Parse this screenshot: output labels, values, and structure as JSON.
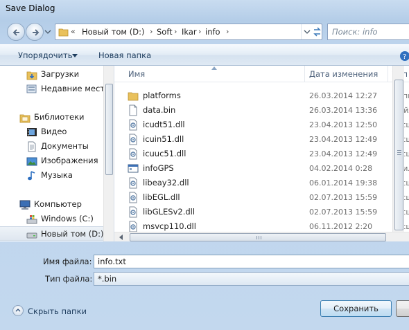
{
  "window": {
    "title": "Save Dialog"
  },
  "address": {
    "overflow": "«",
    "crumbs": [
      "Новый том (D:)",
      "Soft",
      "Ikar",
      "info"
    ],
    "separator": "›"
  },
  "search": {
    "placeholder": "Поиск: info"
  },
  "toolbar": {
    "organize": "Упорядочить",
    "new_folder": "Новая папка"
  },
  "nav": {
    "items": [
      {
        "label": "Загрузки",
        "icon": "downloads-folder-icon"
      },
      {
        "label": "Недавние места",
        "icon": "recent-places-icon"
      },
      {
        "label": "Библиотеки",
        "icon": "libraries-icon"
      },
      {
        "label": "Видео",
        "icon": "video-library-icon"
      },
      {
        "label": "Документы",
        "icon": "documents-library-icon"
      },
      {
        "label": "Изображения",
        "icon": "pictures-library-icon"
      },
      {
        "label": "Музыка",
        "icon": "music-library-icon"
      },
      {
        "label": "Компьютер",
        "icon": "computer-icon"
      },
      {
        "label": "Windows (C:)",
        "icon": "system-drive-icon"
      },
      {
        "label": "Новый том (D:)",
        "icon": "drive-icon",
        "selected": true
      }
    ]
  },
  "columns": {
    "name": "Имя",
    "date": "Дата изменения",
    "type": "Тип"
  },
  "files": [
    {
      "name": "platforms",
      "date": "26.03.2014 12:27",
      "type": "Папк",
      "icon": "folder-icon"
    },
    {
      "name": "data.bin",
      "date": "26.03.2014 13:36",
      "type": "Файл",
      "icon": "file-icon"
    },
    {
      "name": "icudt51.dll",
      "date": "23.04.2013 12:50",
      "type": "Расш",
      "icon": "dll-icon"
    },
    {
      "name": "icuin51.dll",
      "date": "23.04.2013 12:49",
      "type": "Расш",
      "icon": "dll-icon"
    },
    {
      "name": "icuuc51.dll",
      "date": "23.04.2013 12:49",
      "type": "Расш",
      "icon": "dll-icon"
    },
    {
      "name": "infoGPS",
      "date": "04.02.2014 0:28",
      "type": "Прил",
      "icon": "application-icon"
    },
    {
      "name": "libeay32.dll",
      "date": "06.01.2014 19:38",
      "type": "Расш",
      "icon": "dll-icon"
    },
    {
      "name": "libEGL.dll",
      "date": "02.07.2013 15:59",
      "type": "Расш",
      "icon": "dll-icon"
    },
    {
      "name": "libGLESv2.dll",
      "date": "02.07.2013 15:59",
      "type": "Расш",
      "icon": "dll-icon"
    },
    {
      "name": "msvcp110.dll",
      "date": "06.11.2012 2:20",
      "type": "Расш",
      "icon": "dll-icon"
    }
  ],
  "form": {
    "filename_label": "Имя файла:",
    "filename_value": "info.txt",
    "filetype_label": "Тип файла:",
    "filetype_value": "*.bin"
  },
  "footer": {
    "hide_folders": "Скрыть папки",
    "save": "Сохранить",
    "cancel": ""
  },
  "colors": {
    "frame": "#bcd3ec",
    "accent_text": "#1e3d5e",
    "folder": "#e9c15c"
  }
}
